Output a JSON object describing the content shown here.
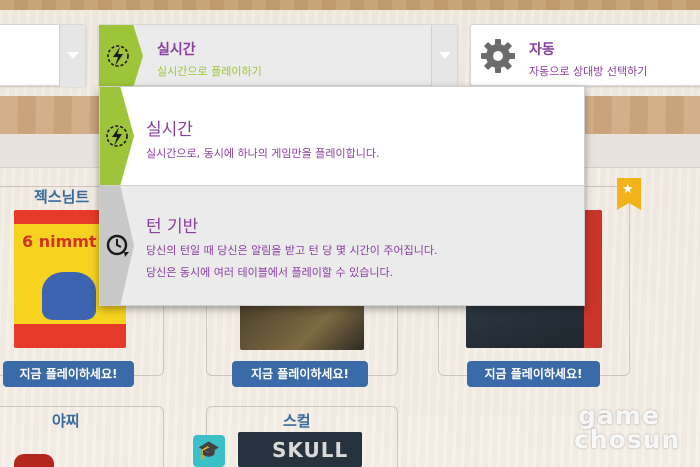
{
  "mode_selector": {
    "title": "실시간",
    "subtitle": "실시간으로 플레이하기"
  },
  "opponent_selector": {
    "title": "자동",
    "subtitle": "자동으로 상대방 선택하기"
  },
  "dropdown": {
    "options": [
      {
        "title": "실시간",
        "desc_line1": "실시간으로, 동시에 하나의 게임만을 플레이합니다."
      },
      {
        "title": "턴 기반",
        "desc_line1": "당신의 턴일 때 당신은 알림을 받고 턴 당 몇 시간이 주어집니다.",
        "desc_line2": "당신은 동시에 여러 테이블에서 플레이할 수 있습니다."
      }
    ]
  },
  "games": [
    {
      "title": "젝스님트",
      "box_text": "6 nimmt!",
      "play_label": "지금 플레이하세요!"
    },
    {
      "title": "",
      "play_label": "지금 플레이하세요!"
    },
    {
      "title": "",
      "play_label": "지금 플레이하세요!"
    },
    {
      "title": "야찌"
    },
    {
      "title": "스컬",
      "box_text": "SKULL"
    }
  ],
  "watermark": {
    "line1": "game",
    "line2": "chosun"
  },
  "colors": {
    "accent_green": "#9ec53a",
    "accent_purple": "#8a3fa0",
    "button_blue": "#3b6aa8",
    "title_blue": "#3a6b9c"
  },
  "icons": {
    "realtime": "lightning-clock-icon",
    "turn_based": "rotate-clock-icon",
    "automatic": "gear-icon",
    "featured": "star-badge-icon",
    "tutorial": "graduation-cap-icon"
  }
}
